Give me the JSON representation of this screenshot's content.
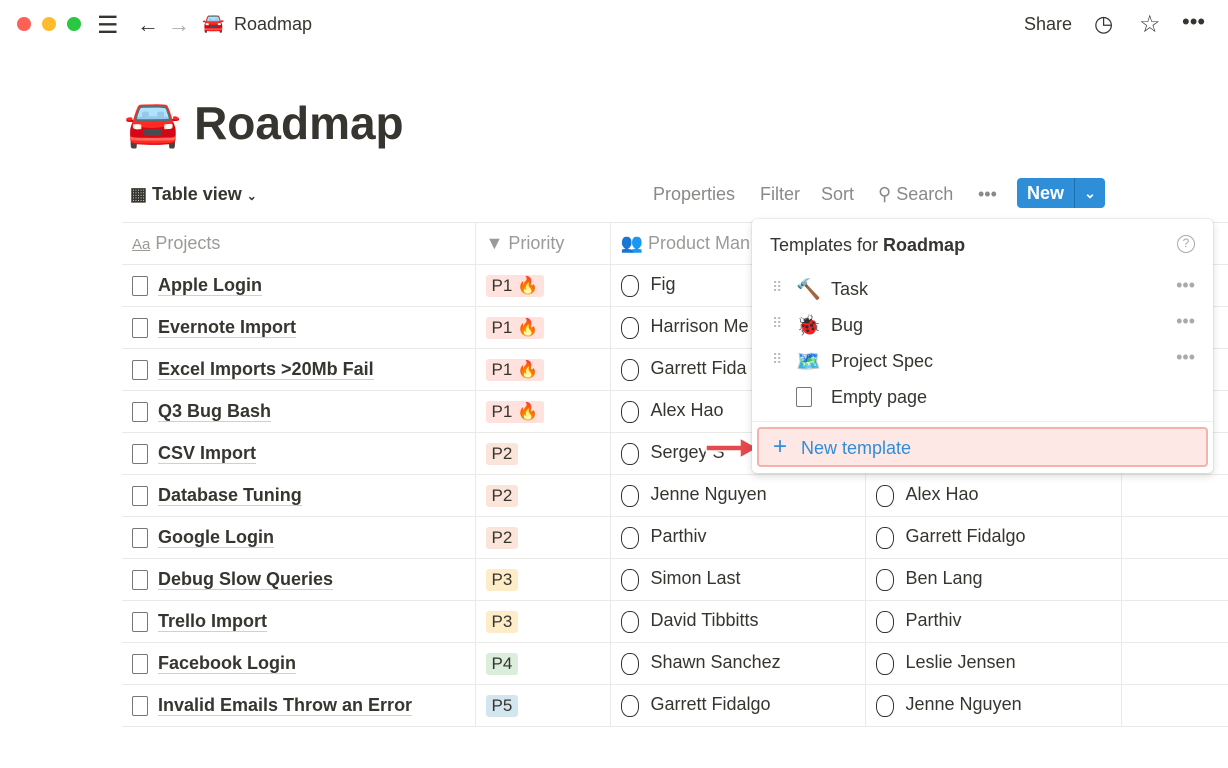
{
  "breadcrumb": {
    "icon": "🚘",
    "title": "Roadmap"
  },
  "topbar": {
    "share": "Share"
  },
  "page": {
    "icon": "🚘",
    "title": "Roadmap"
  },
  "toolbar": {
    "view": "Table view",
    "properties": "Properties",
    "filter": "Filter",
    "sort": "Sort",
    "search": "Search",
    "new": "New"
  },
  "columns": {
    "projects": "Projects",
    "priority": "Priority",
    "pm": "Product Man"
  },
  "rows": [
    {
      "name": "Apple Login",
      "priority": "P1 🔥",
      "pm": "Fig",
      "other": ""
    },
    {
      "name": "Evernote Import",
      "priority": "P1 🔥",
      "pm": "Harrison Me",
      "other": ""
    },
    {
      "name": "Excel Imports >20Mb Fail",
      "priority": "P1 🔥",
      "pm": "Garrett Fida",
      "other": ""
    },
    {
      "name": "Q3 Bug Bash",
      "priority": "P1 🔥",
      "pm": "Alex Hao",
      "other": ""
    },
    {
      "name": "CSV Import",
      "priority": "P2",
      "pm": "Sergey S",
      "other": ""
    },
    {
      "name": "Database Tuning",
      "priority": "P2",
      "pm": "Jenne Nguyen",
      "other": "Alex Hao"
    },
    {
      "name": "Google Login",
      "priority": "P2",
      "pm": "Parthiv",
      "other": "Garrett Fidalgo"
    },
    {
      "name": "Debug Slow Queries",
      "priority": "P3",
      "pm": "Simon Last",
      "other": "Ben Lang"
    },
    {
      "name": "Trello Import",
      "priority": "P3",
      "pm": "David Tibbitts",
      "other": "Parthiv"
    },
    {
      "name": "Facebook Login",
      "priority": "P4",
      "pm": "Shawn Sanchez",
      "other": "Leslie Jensen"
    },
    {
      "name": "Invalid Emails Throw an Error",
      "priority": "P5",
      "pm": "Garrett Fidalgo",
      "other": "Jenne Nguyen"
    }
  ],
  "priority_colors": {
    "P1": "#ffe2dd",
    "P2": "#fbe4d9",
    "P3": "#fdecc8",
    "P4": "#dbeddb",
    "P5": "#d3e5ef"
  },
  "templates": {
    "heading_prefix": "Templates for ",
    "heading_db": "Roadmap",
    "items": [
      {
        "icon": "🔨",
        "label": "Task"
      },
      {
        "icon": "🐞",
        "label": "Bug"
      },
      {
        "icon": "🗺️",
        "label": "Project Spec"
      },
      {
        "icon": "",
        "label": "Empty page"
      }
    ],
    "new_template": "New template"
  }
}
